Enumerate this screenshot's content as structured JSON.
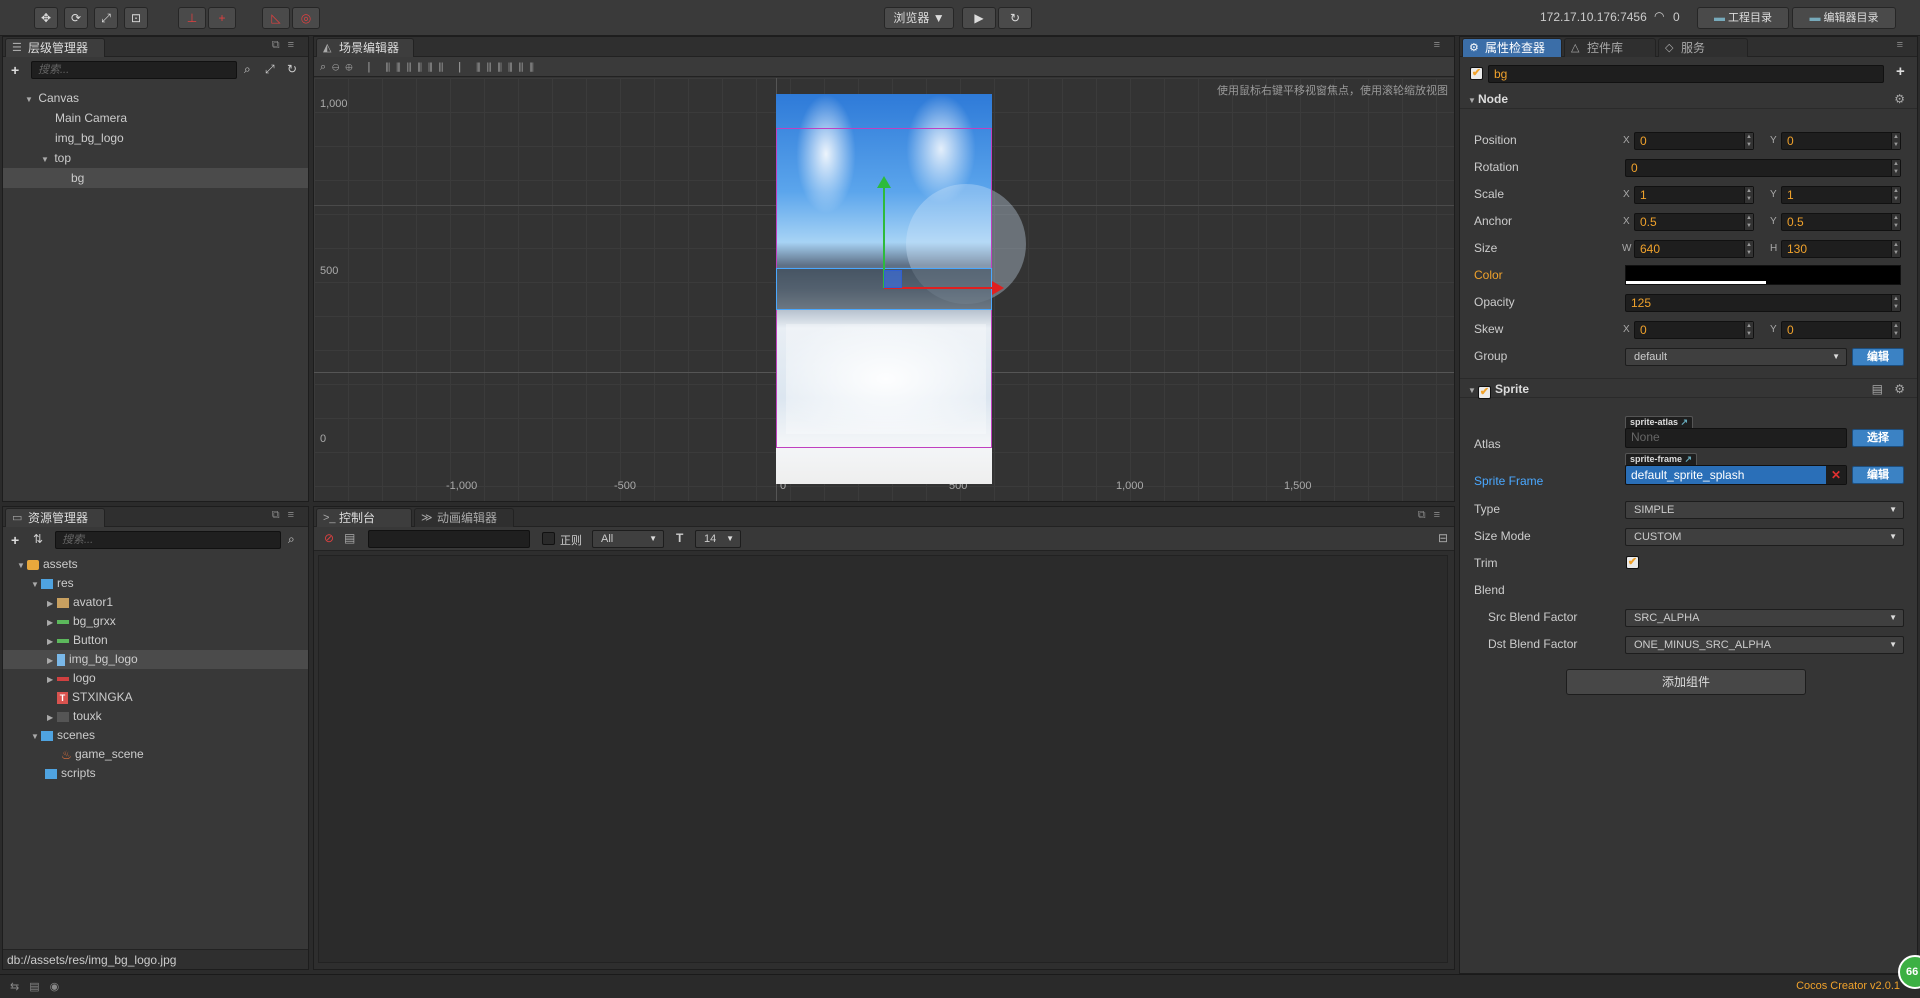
{
  "toolbar": {
    "preview_label": "浏览器 ▼",
    "ip": "172.17.10.176:7456",
    "conn_count": "0",
    "project_dir": "工程目录",
    "editor_dir": "编辑器目录"
  },
  "hierarchy": {
    "tab": "层级管理器",
    "search_placeholder": "搜索...",
    "items": [
      {
        "label": "Canvas"
      },
      {
        "label": "Main Camera"
      },
      {
        "label": "img_bg_logo"
      },
      {
        "label": "top"
      },
      {
        "label": "bg"
      }
    ]
  },
  "scene": {
    "tab": "场景编辑器",
    "hint": "使用鼠标右键平移视窗焦点，使用滚轮缩放视图",
    "y_ticks": [
      "1,000",
      "500",
      "0"
    ],
    "x_ticks": [
      "-1,000",
      "-500",
      "0",
      "500",
      "1,000",
      "1,500"
    ]
  },
  "assets": {
    "tab": "资源管理器",
    "search_placeholder": "搜索...",
    "items": [
      {
        "label": "assets"
      },
      {
        "label": "res"
      },
      {
        "label": "avator1"
      },
      {
        "label": "bg_grxx"
      },
      {
        "label": "Button"
      },
      {
        "label": "img_bg_logo"
      },
      {
        "label": "logo"
      },
      {
        "label": "STXINGKA"
      },
      {
        "label": "touxk"
      },
      {
        "label": "scenes"
      },
      {
        "label": "game_scene"
      },
      {
        "label": "scripts"
      }
    ],
    "path": "db://assets/res/img_bg_logo.jpg"
  },
  "console": {
    "tab": "控制台",
    "anim_tab": "动画编辑器",
    "regex_label": "正则",
    "level": "All",
    "font_size": "14"
  },
  "inspector": {
    "tab": "属性检查器",
    "tab2": "控件库",
    "tab3": "服务",
    "node_name": "bg",
    "node_section": "Node",
    "position": {
      "label": "Position",
      "x": "0",
      "y": "0"
    },
    "rotation": {
      "label": "Rotation",
      "value": "0"
    },
    "scale": {
      "label": "Scale",
      "x": "1",
      "y": "1"
    },
    "anchor": {
      "label": "Anchor",
      "x": "0.5",
      "y": "0.5"
    },
    "size": {
      "label": "Size",
      "w": "640",
      "h": "130"
    },
    "color": {
      "label": "Color"
    },
    "opacity": {
      "label": "Opacity",
      "value": "125"
    },
    "skew": {
      "label": "Skew",
      "x": "0",
      "y": "0"
    },
    "group": {
      "label": "Group",
      "value": "default",
      "edit": "编辑"
    },
    "sprite_section": "Sprite",
    "atlas": {
      "label": "Atlas",
      "tag": "sprite-atlas",
      "value": "None",
      "btn": "选择"
    },
    "sprite_frame": {
      "label": "Sprite Frame",
      "tag": "sprite-frame",
      "value": "default_sprite_splash",
      "btn": "编辑"
    },
    "type": {
      "label": "Type",
      "value": "SIMPLE"
    },
    "size_mode": {
      "label": "Size Mode",
      "value": "CUSTOM"
    },
    "trim": {
      "label": "Trim"
    },
    "blend": {
      "label": "Blend"
    },
    "src_blend": {
      "label": "Src Blend Factor",
      "value": "SRC_ALPHA"
    },
    "dst_blend": {
      "label": "Dst Blend Factor",
      "value": "ONE_MINUS_SRC_ALPHA"
    },
    "add_component": "添加组件"
  },
  "status": {
    "version": "Cocos Creator v2.0.1",
    "badge": "66"
  },
  "colors": {
    "accent": "#f0a22c",
    "select_blue": "#3b82c4",
    "panel": "#383838"
  }
}
